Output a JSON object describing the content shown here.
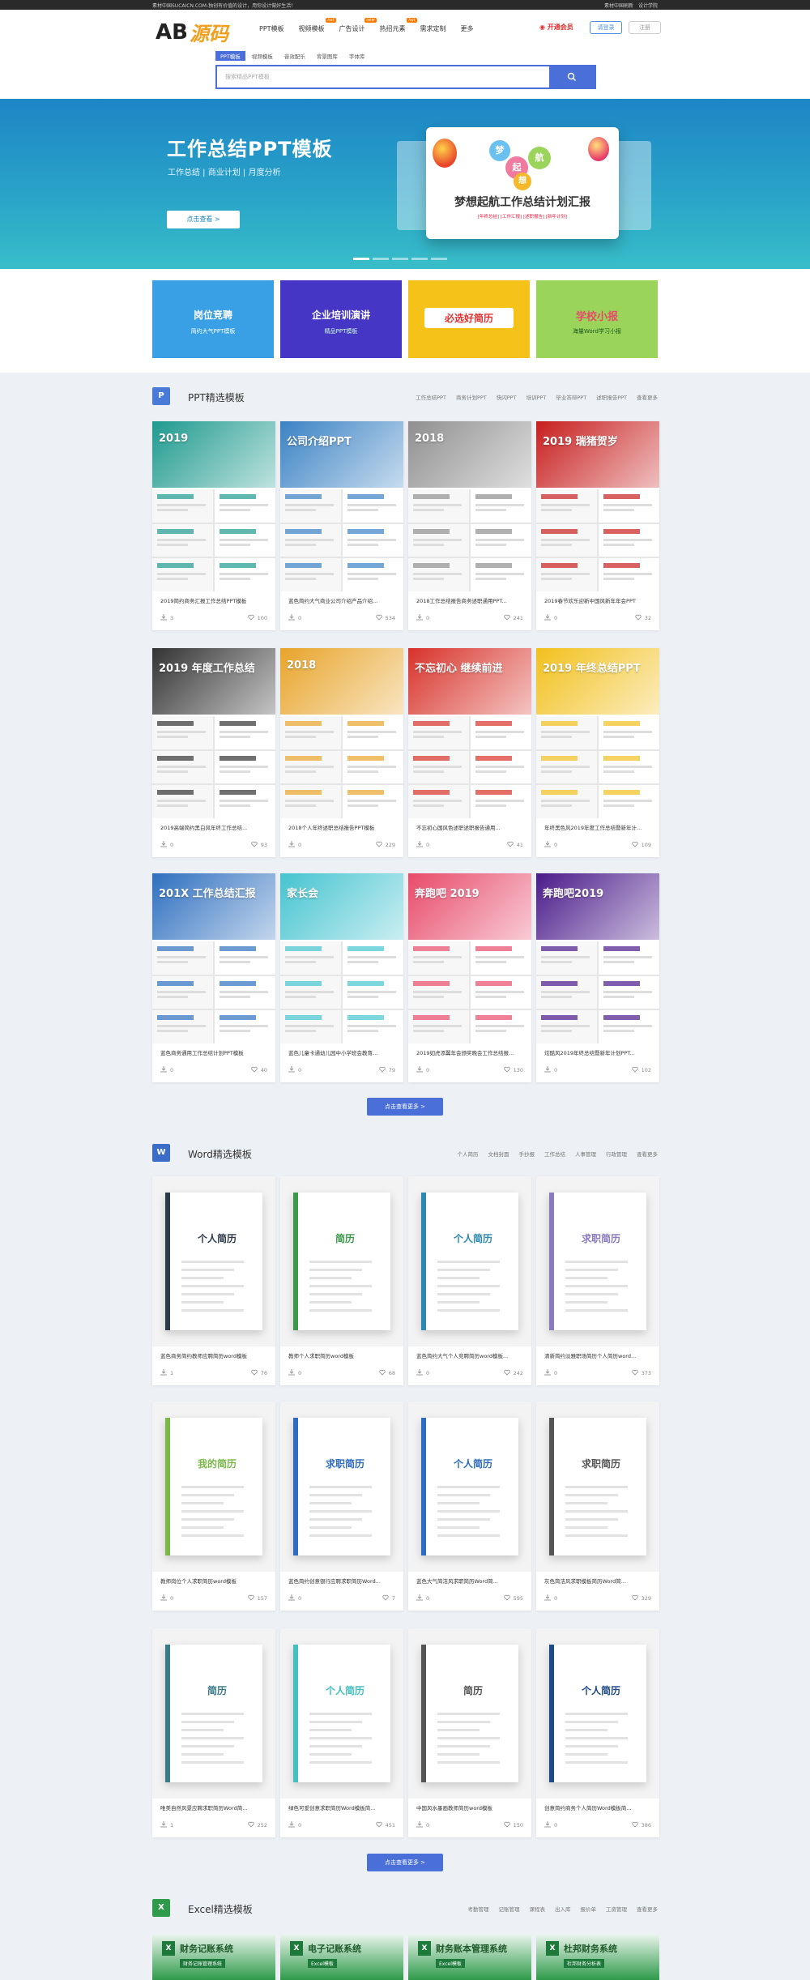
{
  "topbar": {
    "left": "素材中国SUCAICN.COM-独创有价值的设计，用你设计做好生活！",
    "right": [
      "素材中国刷新",
      "设计学院"
    ]
  },
  "header": {
    "logo_ab": "AB",
    "logo_cn": "源码",
    "nav": [
      "PPT模板",
      "视频模板",
      "广告设计",
      "热招元素",
      "需求定制",
      "更多"
    ],
    "nav_tags": {
      "1": "hot",
      "2": "new",
      "3": "hot"
    },
    "vip": "开通会员",
    "login": "请登录",
    "register": "注册"
  },
  "search": {
    "tabs": [
      "PPT模板",
      "视频模板",
      "音效配乐",
      "背景图库",
      "字体库"
    ],
    "placeholder": "搜索精品PPT模板"
  },
  "banner": {
    "title": "工作总结PPT模板",
    "subtitle": "工作总结 | 商业计划 | 月度分析",
    "button": "点击查看 >",
    "card_title": "梦想起航工作总结计划汇报",
    "card_tags": "[年终总结] [工作汇报] [述职报告] [新年计划]",
    "balloon_words": [
      "梦",
      "起",
      "航",
      "想"
    ]
  },
  "promos": [
    {
      "title": "岗位竞聘",
      "sub": "简约大气PPT模板",
      "bg": "#39a0e6"
    },
    {
      "title": "企业培训演讲",
      "sub": "精品PPT模板",
      "bg": "#4536c6"
    },
    {
      "title": "必选好简历",
      "sub": "",
      "bg": "#f5c21a"
    },
    {
      "title": "学校小报",
      "sub": "海量Word学习小报",
      "bg": "#9ad45a"
    }
  ],
  "ppt_section": {
    "icon": "P",
    "title": "PPT精选模板",
    "cats": [
      "工作总结PPT",
      "商务计划PPT",
      "快闪PPT",
      "培训PPT",
      "毕业答辩PPT",
      "述职报告PPT",
      "查看更多"
    ],
    "more": "点击查看更多 >",
    "cards": [
      {
        "title": "2019简约商务汇报工作总结PPT模板",
        "dl": "3",
        "likes": "100",
        "color": "#1e9a8e",
        "top": "2019"
      },
      {
        "title": "蓝色简约大气商业公司介绍产品介绍...",
        "dl": "0",
        "likes": "534",
        "color": "#3a82c4",
        "top": "公司介绍PPT"
      },
      {
        "title": "2018工作总结报告商务述职通用PPT...",
        "dl": "0",
        "likes": "241",
        "color": "#8f8f8f",
        "top": "2018"
      },
      {
        "title": "2019春节欢乐迎新中国风新年年会PPT",
        "dl": "0",
        "likes": "32",
        "color": "#c81e1e",
        "top": "2019 瑞猪贺岁"
      },
      {
        "title": "2019高端简约黑白风年终工作总结...",
        "dl": "0",
        "likes": "93",
        "color": "#333333",
        "top": "2019 年度工作总结"
      },
      {
        "title": "2018个人年终述职总结报告PPT模板",
        "dl": "0",
        "likes": "229",
        "color": "#e8a42a",
        "top": "2018"
      },
      {
        "title": "不忘初心国风色述职述职报告通用...",
        "dl": "0",
        "likes": "41",
        "color": "#d8322a",
        "top": "不忘初心 继续前进"
      },
      {
        "title": "年终黑色风2019年度工作总结暨新年计...",
        "dl": "0",
        "likes": "109",
        "color": "#f2c01c",
        "top": "2019 年终总结PPT"
      },
      {
        "title": "蓝色商务通用工作总结计划PPT模板",
        "dl": "0",
        "likes": "40",
        "color": "#2e6fbf",
        "top": "201X 工作总结汇报"
      },
      {
        "title": "蓝色儿童卡通幼儿园中小学班会教育...",
        "dl": "0",
        "likes": "79",
        "color": "#45c4d0",
        "top": "家长会"
      },
      {
        "title": "2019如虎添翼年会颁奖晚会工作总结报...",
        "dl": "0",
        "likes": "130",
        "color": "#e84a6a",
        "top": "奔跑吧 2019"
      },
      {
        "title": "炫酷风2019年终总结暨新年计划PPT...",
        "dl": "0",
        "likes": "102",
        "color": "#4a1a8a",
        "top": "奔跑吧2019"
      }
    ]
  },
  "word_section": {
    "icon": "W",
    "title": "Word精选模板",
    "cats": [
      "个人简历",
      "文档封面",
      "手抄报",
      "工作总结",
      "人事管理",
      "行政管理",
      "查看更多"
    ],
    "more": "点击查看更多 >",
    "cards": [
      {
        "title": "蓝色商务简约教师应聘简历word模板",
        "dl": "1",
        "likes": "76",
        "doc": "个人简历",
        "accent": "#2d3a4a"
      },
      {
        "title": "教师个人求职简历word模板",
        "dl": "0",
        "likes": "68",
        "doc": "简历",
        "accent": "#3a9a4a"
      },
      {
        "title": "蓝色简约大气个人竞聘简历word模板...",
        "dl": "0",
        "likes": "242",
        "doc": "个人简历",
        "accent": "#2b8ab2"
      },
      {
        "title": "清新简约淡雅职场简历个人简历word...",
        "dl": "0",
        "likes": "373",
        "doc": "求职简历",
        "accent": "#8a7ac0"
      },
      {
        "title": "教师岗位个人求职简历word模板",
        "dl": "0",
        "likes": "157",
        "doc": "我的简历",
        "accent": "#7ab84a"
      },
      {
        "title": "蓝色简约创意银行应聘求职简历Word...",
        "dl": "0",
        "likes": "7",
        "doc": "求职简历",
        "accent": "#2d6cc0"
      },
      {
        "title": "蓝色大气简洁风求职简历Word简...",
        "dl": "0",
        "likes": "595",
        "doc": "个人简历",
        "accent": "#2d6cc0"
      },
      {
        "title": "灰色简洁风求职模板简历Word简...",
        "dl": "0",
        "likes": "329",
        "doc": "求职简历",
        "accent": "#555555"
      },
      {
        "title": "唯美自然风景应聘求职简历Word简...",
        "dl": "1",
        "likes": "252",
        "doc": "简历",
        "accent": "#3a7a8a"
      },
      {
        "title": "绿色可爱创意求职简历Word模板简...",
        "dl": "0",
        "likes": "451",
        "doc": "个人简历",
        "accent": "#45c0c0"
      },
      {
        "title": "中国风水墨画教师简历word模板",
        "dl": "0",
        "likes": "150",
        "doc": "简历",
        "accent": "#555555"
      },
      {
        "title": "创意简约商务个人简历Word模板简...",
        "dl": "0",
        "likes": "386",
        "doc": "个人简历",
        "accent": "#1e4a8a"
      }
    ]
  },
  "excel_section": {
    "icon": "X",
    "title": "Excel精选模板",
    "cats": [
      "考勤管理",
      "记账管理",
      "课程表",
      "出入库",
      "报价单",
      "工资管理",
      "查看更多"
    ],
    "cards": [
      {
        "title": "财务记账系统",
        "sub": "财务记账管理系统"
      },
      {
        "title": "电子记账系统",
        "sub": "Excel模板"
      },
      {
        "title": "财务账本管理系统",
        "sub": "Excel模板"
      },
      {
        "title": "杜邦财务系统",
        "sub": "杜邦财务分析表"
      }
    ]
  }
}
